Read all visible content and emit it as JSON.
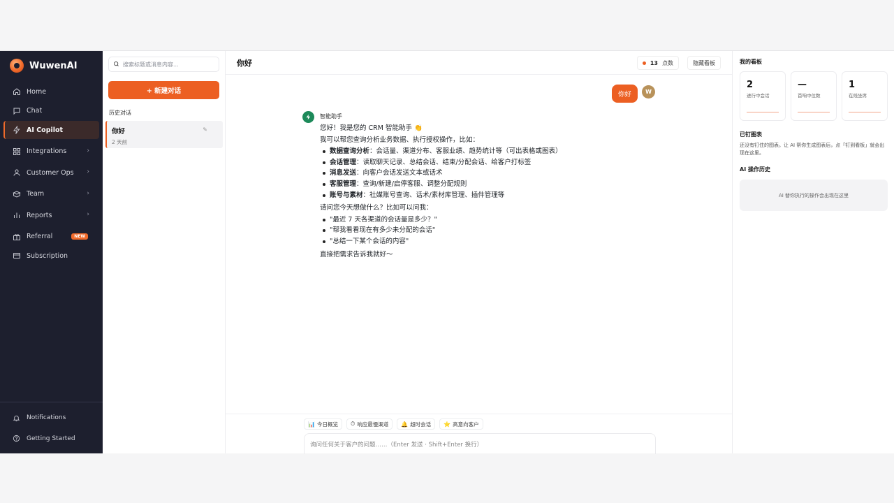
{
  "brand": {
    "name": "WuwenAI"
  },
  "nav": [
    {
      "label": "Home",
      "icon": "home-icon"
    },
    {
      "label": "Chat",
      "icon": "chat-icon"
    },
    {
      "label": "AI Copilot",
      "icon": "bolt-icon",
      "active": true
    },
    {
      "label": "Integrations",
      "icon": "grid-icon",
      "chevron": true
    },
    {
      "label": "Customer Ops",
      "icon": "user-icon",
      "chevron": true
    },
    {
      "label": "Team",
      "icon": "team-icon",
      "chevron": true
    },
    {
      "label": "Reports",
      "icon": "chart-icon",
      "chevron": true
    },
    {
      "label": "Referral",
      "icon": "gift-icon",
      "badge": "NEW"
    },
    {
      "label": "Subscription",
      "icon": "card-icon"
    }
  ],
  "sidebar_bottom": [
    {
      "label": "Notifications",
      "icon": "bell-icon"
    },
    {
      "label": "Getting Started",
      "icon": "help-icon"
    }
  ],
  "history": {
    "search_placeholder": "搜索标题或消息内容...",
    "new_chat": "+ 新建对话",
    "section_label": "历史对话",
    "items": [
      {
        "title": "你好",
        "date": "2 天前"
      }
    ]
  },
  "main": {
    "title": "你好",
    "points_value": "13",
    "points_label": "点数",
    "hide_board": "隐藏看板",
    "user_message": "你好",
    "user_avatar": "W",
    "bot_name": "智能助手",
    "bot_intro": "您好！我是您的 CRM 智能助手 👏",
    "bot_lead": "我可以帮您查询分析业务数据、执行授权操作，比如：",
    "capabilities": [
      {
        "key": "数据查询分析",
        "text": "：会话量、渠道分布、客服业绩、趋势统计等（可出表格或图表）"
      },
      {
        "key": "会话管理",
        "text": "：读取聊天记录、总结会话、结束/分配会话、给客户打标签"
      },
      {
        "key": "消息发送",
        "text": "：向客户会话发送文本或话术"
      },
      {
        "key": "客服管理",
        "text": "：查询/新建/启停客服、调整分配规则"
      },
      {
        "key": "账号与素材",
        "text": "：社媒账号查询、话术/素材库管理、插件管理等"
      }
    ],
    "ask_lead": "请问您今天想做什么？比如可以问我：",
    "examples": [
      "\"最近 7 天各渠道的会话量是多少？\"",
      "\"帮我看看现在有多少未分配的会话\"",
      "\"总结一下某个会话的内容\""
    ],
    "closing": "直接把需求告诉我就好～",
    "chips": [
      {
        "icon": "📊",
        "label": "今日概览"
      },
      {
        "icon": "⏱",
        "label": "响应最慢渠道"
      },
      {
        "icon": "🔔",
        "label": "超时会话"
      },
      {
        "icon": "⭐",
        "label": "高意向客户"
      }
    ],
    "input_placeholder": "询问任何关于客户的问题……（Enter 发送 · Shift+Enter 换行）"
  },
  "board": {
    "title": "我的看板",
    "stats": [
      {
        "value": "2",
        "label": "进行中会话"
      },
      {
        "value": "—",
        "label": "首响中位数"
      },
      {
        "value": "1",
        "label": "在线坐席"
      }
    ],
    "pinned_title": "已钉图表",
    "pinned_desc": "还没有钉住的图表。让 AI 帮你生成图表后，点「钉到看板」就会出现在这里。",
    "ops_title": "AI 操作历史",
    "ops_empty": "AI 替你执行的操作会出现在这里"
  }
}
